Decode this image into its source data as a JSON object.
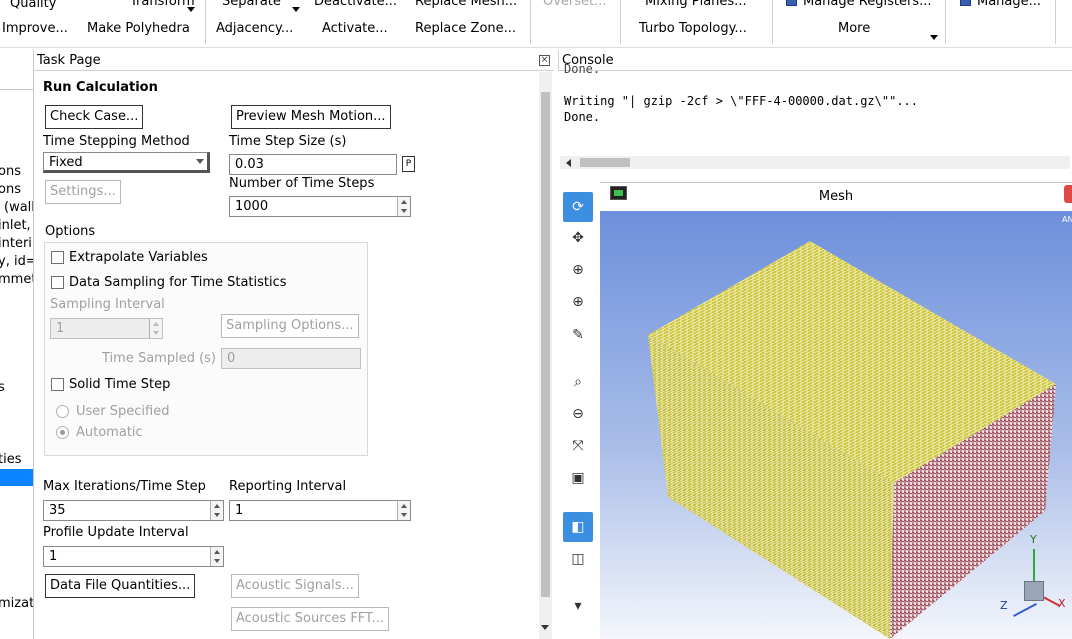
{
  "ribbon": {
    "row1": [
      "Quality",
      "Transform",
      "Separate",
      "Deactivate...",
      "Replace Mesh...",
      "Overset...",
      "Mixing Planes...",
      "Manage Registers...",
      "Manage..."
    ],
    "row2": [
      "Improve...",
      "Make Polyhedra",
      "Adjacency...",
      "Activate...",
      "Replace Zone...",
      "Turbo Topology...",
      "More"
    ]
  },
  "tree": {
    "items": [
      "ons",
      "ons",
      "(wall",
      "inlet,",
      "interi",
      "y, id=",
      "mmet",
      "s",
      "ties",
      "mizat"
    ]
  },
  "task_page": {
    "title": "Task Page",
    "heading": "Run Calculation",
    "check_case": "Check Case...",
    "preview_mesh": "Preview Mesh Motion...",
    "time_stepping_label": "Time Stepping Method",
    "time_stepping_value": "Fixed",
    "time_step_size_label": "Time Step Size (s)",
    "time_step_size_value": "0.03",
    "param_badge": "P",
    "settings_btn": "Settings...",
    "num_steps_label": "Number of Time Steps",
    "num_steps_value": "1000",
    "options_label": "Options",
    "extrapolate": "Extrapolate Variables",
    "data_sampling": "Data Sampling for Time Statistics",
    "sampling_interval_label": "Sampling Interval",
    "sampling_interval_value": "1",
    "sampling_options": "Sampling Options...",
    "time_sampled_label": "Time Sampled (s)",
    "time_sampled_value": "0",
    "solid_time_step": "Solid Time Step",
    "user_specified": "User Specified",
    "automatic": "Automatic",
    "max_iter_label": "Max Iterations/Time Step",
    "max_iter_value": "35",
    "reporting_label": "Reporting Interval",
    "reporting_value": "1",
    "profile_label": "Profile Update Interval",
    "profile_value": "1",
    "data_file_btn": "Data File Quantities...",
    "acoustic_signals": "Acoustic Signals...",
    "acoustic_fft": "Acoustic Sources FFT..."
  },
  "console": {
    "title": "Console",
    "line0": "Done.",
    "line1": "Writing \"| gzip -2cf > \\\"FFF-4-00000.dat.gz\\\"\"...",
    "line2": "Done."
  },
  "graphics": {
    "title": "Mesh",
    "corner_label": "AN",
    "axis_x": "X",
    "axis_y": "Y",
    "axis_z": "Z",
    "tools": [
      "rotate-icon",
      "pan-icon",
      "zoom-box-icon",
      "zoom-in-icon",
      "probe-icon",
      "fit-icon",
      "zoom-out-icon",
      "axes-icon",
      "camera-icon",
      "cube-view-icon",
      "cube-outline-icon",
      "more-tools-icon"
    ]
  },
  "colors": {
    "accent": "#3c8fe0",
    "selection": "#0a84ff",
    "mesh_face": "#c8c23a",
    "mesh_side": "#7a2330",
    "sky_top": "#6d8fdc"
  }
}
